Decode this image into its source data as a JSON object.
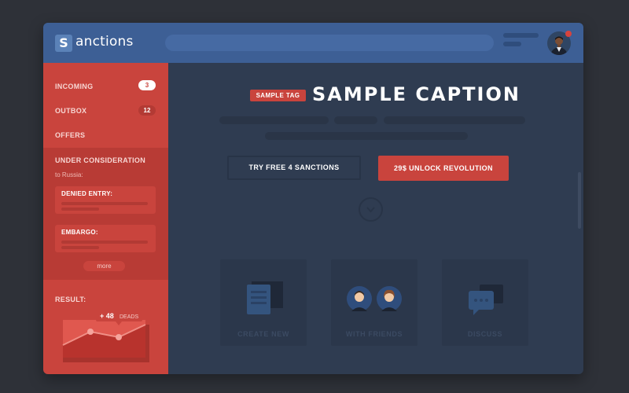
{
  "app": {
    "logo_letter": "S",
    "logo_rest": "anctions"
  },
  "sidebar": {
    "items": [
      {
        "label": "INCOMING",
        "badge": "3"
      },
      {
        "label": "OUTBOX",
        "badge": "12"
      },
      {
        "label": "OFFERS"
      },
      {
        "label": "UNDER CONSIDERATION"
      }
    ],
    "consideration": {
      "sub": "to Russia:",
      "cards": [
        "DENIED ENTRY:",
        "EMBARGO:"
      ],
      "more": "more"
    },
    "result": {
      "label": "RESULT:",
      "value": "+ 48",
      "unit": "DEADS"
    }
  },
  "hero": {
    "tag": "SAMPLE TAG",
    "caption": "SAMPLE CAPTION",
    "btn_trial": "TRY FREE 4 SANCTIONS",
    "btn_unlock": "29$  UNLOCK REVOLUTION"
  },
  "features": [
    {
      "label": "CREATE NEW",
      "icon": "document-icon"
    },
    {
      "label": "WITH FRIENDS",
      "icon": "users-icon"
    },
    {
      "label": "DISCUSS",
      "icon": "chat-icon"
    }
  ],
  "colors": {
    "topbar": "#3d5f95",
    "sidebar": "#c9443d",
    "main": "#2f3c51",
    "accent": "#c9443d"
  }
}
